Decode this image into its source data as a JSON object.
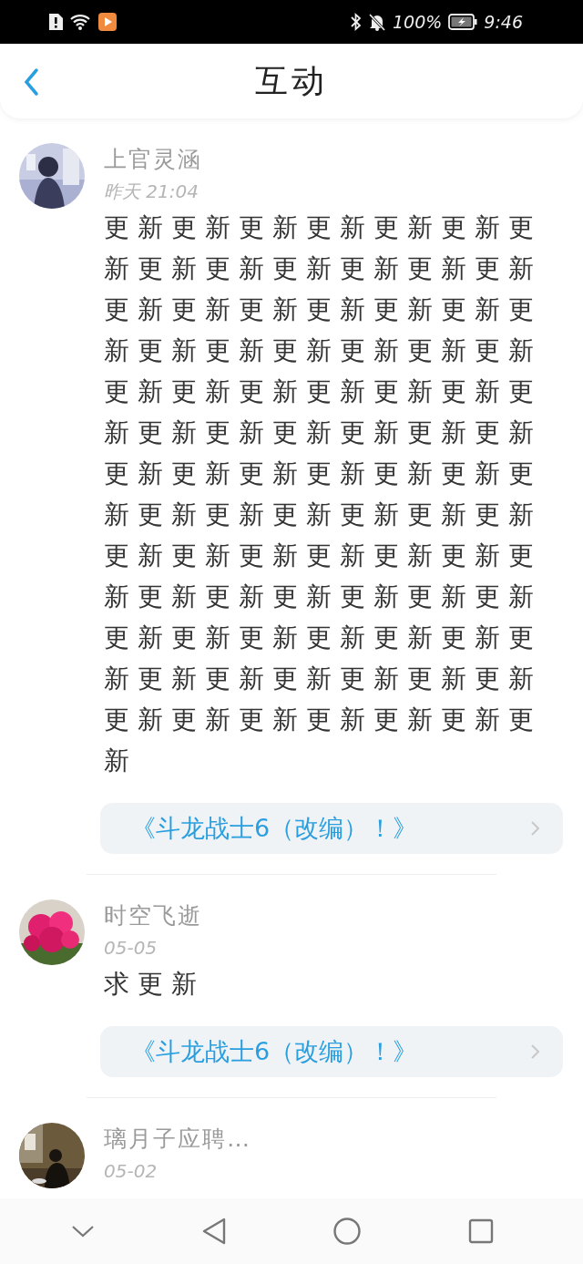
{
  "status_bar": {
    "battery": "100%",
    "time": "9:46"
  },
  "header": {
    "title": "互动"
  },
  "comments": [
    {
      "name": "上官灵涵",
      "time": "昨天 21:04",
      "text": "更新更新更新更新更新更新更新更新更新更新更新更新更新更新更新更新更新更新更新更新更新更新更新更新更新更新更新更新更新更新更新更新更新更新更新更新更新更新更新更新更新更新更新更新更新更新更新更新更新更新更新更新更新更新更新更新更新更新更新更新更新更新更新更新更新更新更新更新更新更新更新更新更新更新更新更新更新更新更新更新更新更新更新更新更新",
      "link": "《斗龙战士6（改编）！》"
    },
    {
      "name": "时空飞逝",
      "time": "05-05",
      "text": "求更新",
      "link": "《斗龙战士6（改编）！》"
    },
    {
      "name": "璃月子应聘…",
      "time": "05-02"
    }
  ]
}
